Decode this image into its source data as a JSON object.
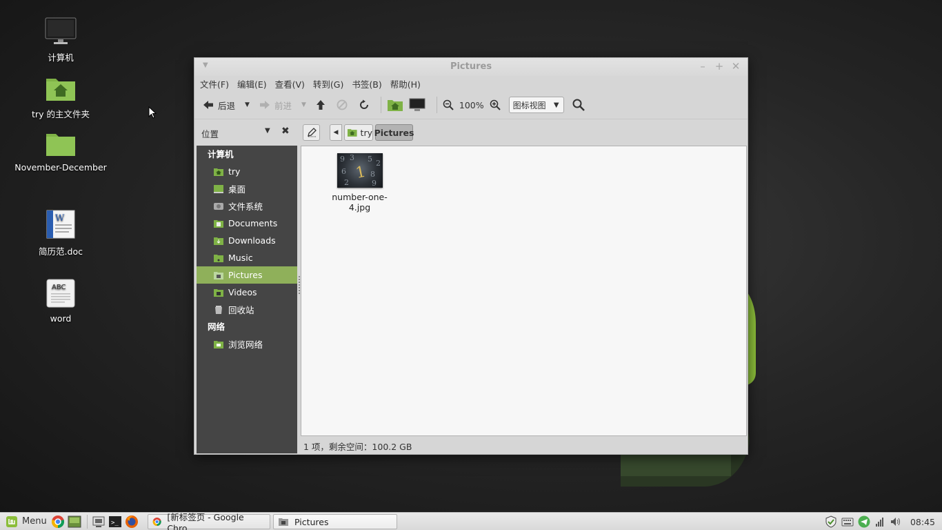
{
  "desktop": {
    "icons": [
      {
        "label": "计算机"
      },
      {
        "label": "try 的主文件夹"
      },
      {
        "label": "November-December"
      },
      {
        "label": "简历范.doc"
      },
      {
        "label": "word"
      }
    ]
  },
  "window": {
    "title": "Pictures",
    "menus": [
      "文件(F)",
      "编辑(E)",
      "查看(V)",
      "转到(G)",
      "书签(B)",
      "帮助(H)"
    ],
    "toolbar": {
      "back_label": "后退",
      "forward_label": "前进",
      "zoom_level": "100%",
      "view_mode": "图标视图"
    },
    "places_label": "位置",
    "breadcrumb": {
      "home": "try",
      "current": "Pictures"
    },
    "sidebar": {
      "computer_header": "计算机",
      "computer_items": [
        {
          "label": "try",
          "icon": "home-folder-icon"
        },
        {
          "label": "桌面",
          "icon": "desktop-icon"
        },
        {
          "label": "文件系统",
          "icon": "drive-icon"
        },
        {
          "label": "Documents",
          "icon": "folder-icon"
        },
        {
          "label": "Downloads",
          "icon": "folder-icon"
        },
        {
          "label": "Music",
          "icon": "folder-icon"
        },
        {
          "label": "Pictures",
          "icon": "folder-icon",
          "selected": true
        },
        {
          "label": "Videos",
          "icon": "folder-icon"
        },
        {
          "label": "回收站",
          "icon": "trash-icon"
        }
      ],
      "network_header": "网络",
      "network_items": [
        {
          "label": "浏览网络",
          "icon": "network-icon"
        }
      ]
    },
    "files": [
      {
        "name": "number-one-4.jpg"
      }
    ],
    "status": "1 项，剩余空间：100.2 GB"
  },
  "panel": {
    "menu_label": "Menu",
    "tasks": [
      {
        "label": "[新标签页 - Google Chro..."
      },
      {
        "label": "Pictures"
      }
    ],
    "clock": "08:45"
  },
  "colors": {
    "accent": "#8fb05a",
    "sidebar_bg": "#454545",
    "window_bg": "#d6d6d6"
  }
}
